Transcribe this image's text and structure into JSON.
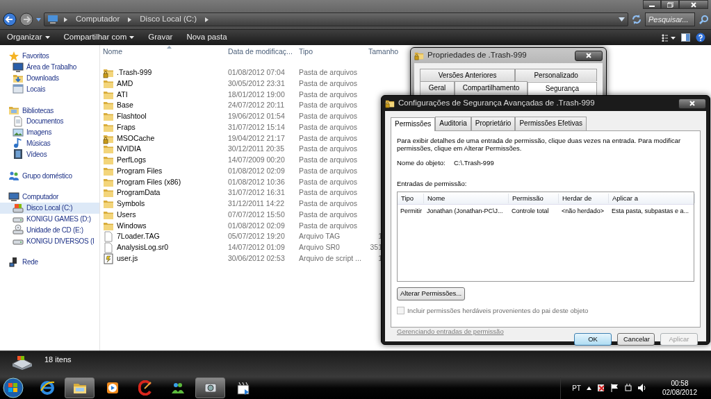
{
  "explorer": {
    "breadcrumb": [
      "Computador",
      "Disco Local (C:)"
    ],
    "search": {
      "placeholder": "Pesquisar..."
    },
    "toolbar": [
      {
        "label": "Organizar",
        "menu": true
      },
      {
        "label": "Compartilhar com",
        "menu": true
      },
      {
        "label": "Gravar",
        "menu": false
      },
      {
        "label": "Nova pasta",
        "menu": false
      }
    ],
    "sidebar": [
      {
        "label": "Favoritos",
        "kind": "star",
        "selected": false,
        "children": [
          {
            "label": "Área de Trabalho",
            "kind": "desktop",
            "selected": false
          },
          {
            "label": "Downloads",
            "kind": "downloads",
            "selected": false
          },
          {
            "label": "Locais",
            "kind": "places",
            "selected": false
          }
        ]
      },
      {
        "label": "Bibliotecas",
        "kind": "library",
        "selected": false,
        "children": [
          {
            "label": "Documentos",
            "kind": "document",
            "selected": false
          },
          {
            "label": "Imagens",
            "kind": "pictures",
            "selected": false
          },
          {
            "label": "Músicas",
            "kind": "music",
            "selected": false
          },
          {
            "label": "Vídeos",
            "kind": "video",
            "selected": false
          }
        ]
      },
      {
        "label": "Grupo doméstico",
        "kind": "homegroup",
        "selected": false
      },
      {
        "label": "Computador",
        "kind": "computer",
        "selected": false,
        "children": [
          {
            "label": "Disco Local (C:)",
            "kind": "disk",
            "selected": true
          },
          {
            "label": "KONIGU GAMES (D:)",
            "kind": "drive",
            "selected": false
          },
          {
            "label": "Unidade de CD (E:)",
            "kind": "cd",
            "selected": false
          },
          {
            "label": "KONIGU DIVERSOS (I",
            "kind": "drive",
            "selected": false
          }
        ]
      },
      {
        "label": "Rede",
        "kind": "network",
        "selected": false
      }
    ],
    "columns": [
      "Nome",
      "Data de modificaç...",
      "Tipo",
      "Tamanho"
    ],
    "files": [
      {
        "name": ".Trash-999",
        "date": "01/08/2012 07:04",
        "type": "Pasta de arquivos",
        "kind": "locked_folder"
      },
      {
        "name": "AMD",
        "date": "30/05/2012 23:31",
        "type": "Pasta de arquivos",
        "kind": "folder"
      },
      {
        "name": "ATI",
        "date": "18/01/2012 19:00",
        "type": "Pasta de arquivos",
        "kind": "folder"
      },
      {
        "name": "Base",
        "date": "24/07/2012 20:11",
        "type": "Pasta de arquivos",
        "kind": "folder"
      },
      {
        "name": "Flashtool",
        "date": "19/06/2012 01:54",
        "type": "Pasta de arquivos",
        "kind": "folder"
      },
      {
        "name": "Fraps",
        "date": "31/07/2012 15:14",
        "type": "Pasta de arquivos",
        "kind": "folder"
      },
      {
        "name": "MSOCache",
        "date": "19/04/2012 21:17",
        "type": "Pasta de arquivos",
        "kind": "locked_folder"
      },
      {
        "name": "NVIDIA",
        "date": "30/12/2011 20:35",
        "type": "Pasta de arquivos",
        "kind": "folder"
      },
      {
        "name": "PerfLogs",
        "date": "14/07/2009 00:20",
        "type": "Pasta de arquivos",
        "kind": "folder"
      },
      {
        "name": "Program Files",
        "date": "01/08/2012 02:09",
        "type": "Pasta de arquivos",
        "kind": "folder"
      },
      {
        "name": "Program Files (x86)",
        "date": "01/08/2012 10:36",
        "type": "Pasta de arquivos",
        "kind": "folder"
      },
      {
        "name": "ProgramData",
        "date": "31/07/2012 16:31",
        "type": "Pasta de arquivos",
        "kind": "folder"
      },
      {
        "name": "Symbols",
        "date": "31/12/2011 14:22",
        "type": "Pasta de arquivos",
        "kind": "folder"
      },
      {
        "name": "Users",
        "date": "07/07/2012 15:50",
        "type": "Pasta de arquivos",
        "kind": "folder"
      },
      {
        "name": "Windows",
        "date": "01/08/2012 02:09",
        "type": "Pasta de arquivos",
        "kind": "folder"
      },
      {
        "name": "7Loader.TAG",
        "date": "05/07/2012 19:20",
        "type": "Arquivo TAG",
        "size": "1",
        "kind": "file"
      },
      {
        "name": "AnalysisLog.sr0",
        "date": "14/07/2012 01:09",
        "type": "Arquivo SR0",
        "size": "351",
        "kind": "file"
      },
      {
        "name": "user.js",
        "date": "30/06/2012 02:53",
        "type": "Arquivo de script ...",
        "size": "1",
        "kind": "script"
      }
    ],
    "status": "18 itens"
  },
  "properties_dialog": {
    "title": "Propriedades de .Trash-999",
    "tab_rows": [
      [
        {
          "label": "Versões Anteriores",
          "selected": false
        },
        {
          "label": "Personalizado",
          "selected": false
        }
      ],
      [
        {
          "label": "Geral",
          "selected": false
        },
        {
          "label": "Compartilhamento",
          "selected": false
        },
        {
          "label": "Segurança",
          "selected": true
        }
      ]
    ]
  },
  "security_dialog": {
    "title": "Configurações de Segurança Avançadas de .Trash-999",
    "tabs": [
      {
        "label": "Permissões",
        "selected": true
      },
      {
        "label": "Auditoria",
        "selected": false
      },
      {
        "label": "Proprietário",
        "selected": false
      },
      {
        "label": "Permissões Efetivas",
        "selected": false
      }
    ],
    "description": "Para exibir detalhes de uma entrada de permissão, clique duas vezes na entrada. Para modificar permissões, clique em Alterar Permissões.",
    "object_label": "Nome do objeto:",
    "object_value": "C:\\.Trash-999",
    "entries_label": "Entradas de permissão:",
    "columns": [
      "Tipo",
      "Nome",
      "Permissão",
      "Herdar de",
      "Aplicar a"
    ],
    "rows": [
      [
        "Permitir",
        "Jonathan (Jonathan-PC\\J...",
        "Controle total",
        "<não herdado>",
        "Esta pasta, subpastas e a..."
      ]
    ],
    "change_button": "Alterar Permissões...",
    "inherit_checkbox": {
      "label": "Incluir permissões herdáveis provenientes do pai deste objeto",
      "checked": false,
      "disabled": true
    },
    "link": {
      "label": "Gerenciando entradas de permissão",
      "disabled": true
    },
    "buttons": [
      {
        "label": "OK",
        "kind": "default"
      },
      {
        "label": "Cancelar",
        "kind": "normal"
      },
      {
        "label": "Aplicar",
        "kind": "disabled"
      }
    ]
  },
  "taskbar": {
    "apps": [
      {
        "kind": "browser",
        "active": false
      },
      {
        "kind": "explorer",
        "active": true
      },
      {
        "kind": "media",
        "active": false
      },
      {
        "kind": "cleaner",
        "active": false
      },
      {
        "kind": "messenger",
        "active": false
      },
      {
        "kind": "disc",
        "active": true
      },
      {
        "kind": "calendar",
        "active": false
      }
    ],
    "language": "PT",
    "time": "00:58",
    "date": "02/08/2012"
  }
}
